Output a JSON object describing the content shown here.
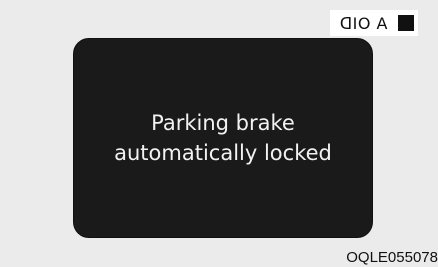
{
  "corner_label": {
    "text": "ᗡIO A",
    "icon": "filled-square-icon"
  },
  "display": {
    "line1": "Parking brake",
    "line2": "automatically locked"
  },
  "reference_code": "OQLE055078"
}
